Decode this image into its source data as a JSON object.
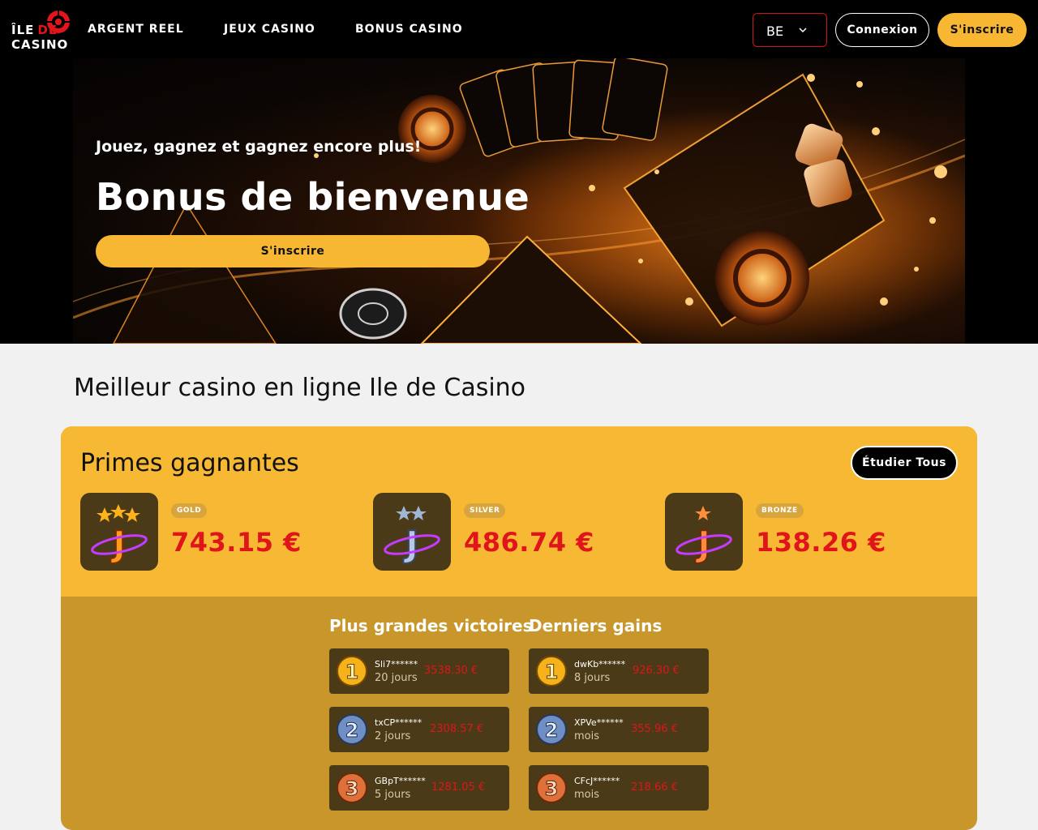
{
  "header": {
    "logo": {
      "line1": "ÎLE",
      "de": "DE",
      "line2": "CASINO"
    },
    "nav": [
      "ARGENT REEL",
      "JEUX CASINO",
      "BONUS CASINO"
    ],
    "lang": "BE",
    "login": "Connexion",
    "signup": "S'inscrire"
  },
  "hero": {
    "subtitle": "Jouez, gagnez et gagnez encore plus!",
    "title": "Bonus de bienvenue",
    "cta": "S'inscrire"
  },
  "section_title": "Meilleur casino en ligne Ile de Casino",
  "prizes": {
    "title": "Primes gagnantes",
    "explore": "Étudier Tous",
    "tiers": [
      {
        "badge": "GOLD",
        "amount": "743.15 €",
        "stars": 3
      },
      {
        "badge": "SILVER",
        "amount": "486.74 €",
        "stars": 2
      },
      {
        "badge": "BRONZE",
        "amount": "138.26 €",
        "stars": 1
      }
    ],
    "biggest_title": "Plus grandes victoires",
    "latest_title": "Derniers gains",
    "biggest": [
      {
        "rank": "1",
        "user": "Sli7******",
        "when": "20 jours",
        "amount": "3538.30 €"
      },
      {
        "rank": "2",
        "user": "txCP******",
        "when": "2 jours",
        "amount": "2308.57 €"
      },
      {
        "rank": "3",
        "user": "GBpT******",
        "when": "5 jours",
        "amount": "1281.05 €"
      }
    ],
    "latest": [
      {
        "rank": "1",
        "user": "dwKb******",
        "when": "8 jours",
        "amount": "926.30 €"
      },
      {
        "rank": "2",
        "user": "XPVe******",
        "when": "mois",
        "amount": "355.96 €"
      },
      {
        "rank": "3",
        "user": "CFcJ******",
        "when": "mois",
        "amount": "218.66 €"
      }
    ]
  },
  "colors": {
    "accent": "#f7b733",
    "red": "#e0151b",
    "panel_dark": "#4b3a17"
  }
}
